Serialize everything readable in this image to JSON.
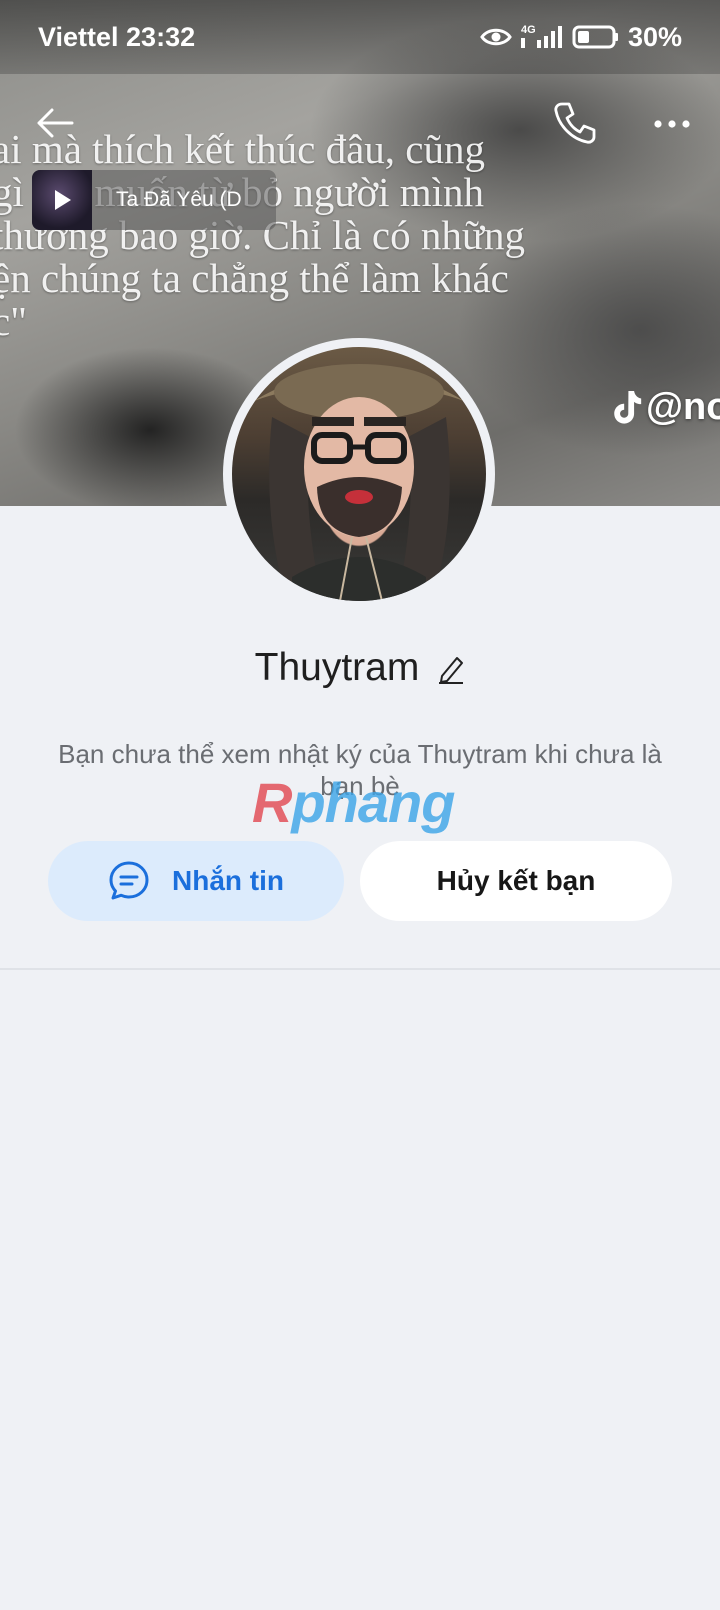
{
  "status_bar": {
    "carrier_time": "Viettel 23:32",
    "network": "4G",
    "battery": "30%"
  },
  "cover": {
    "quote_lines": [
      "ai mà thích kết thúc đâu, cũng",
      "gì vai muốn từ bỏ người mình",
      "thương bao giờ. Chỉ là có những",
      "ện chúng ta chẳng thể làm khác",
      "c\""
    ],
    "tiktok_handle": "@no"
  },
  "music": {
    "title": "Ta Đã Yêu (D"
  },
  "profile": {
    "name": "Thuytram",
    "notice": "Bạn chưa thể xem nhật ký của Thuytram khi chưa là bạn bè"
  },
  "watermark": {
    "first_letter": "R",
    "rest": "phang"
  },
  "actions": {
    "message_label": "Nhắn tin",
    "unfriend_label": "Hủy kết bạn"
  },
  "colors": {
    "accent_blue": "#1b6fdc",
    "message_bg": "#dcebfc",
    "page_bg": "#eff1f5"
  }
}
